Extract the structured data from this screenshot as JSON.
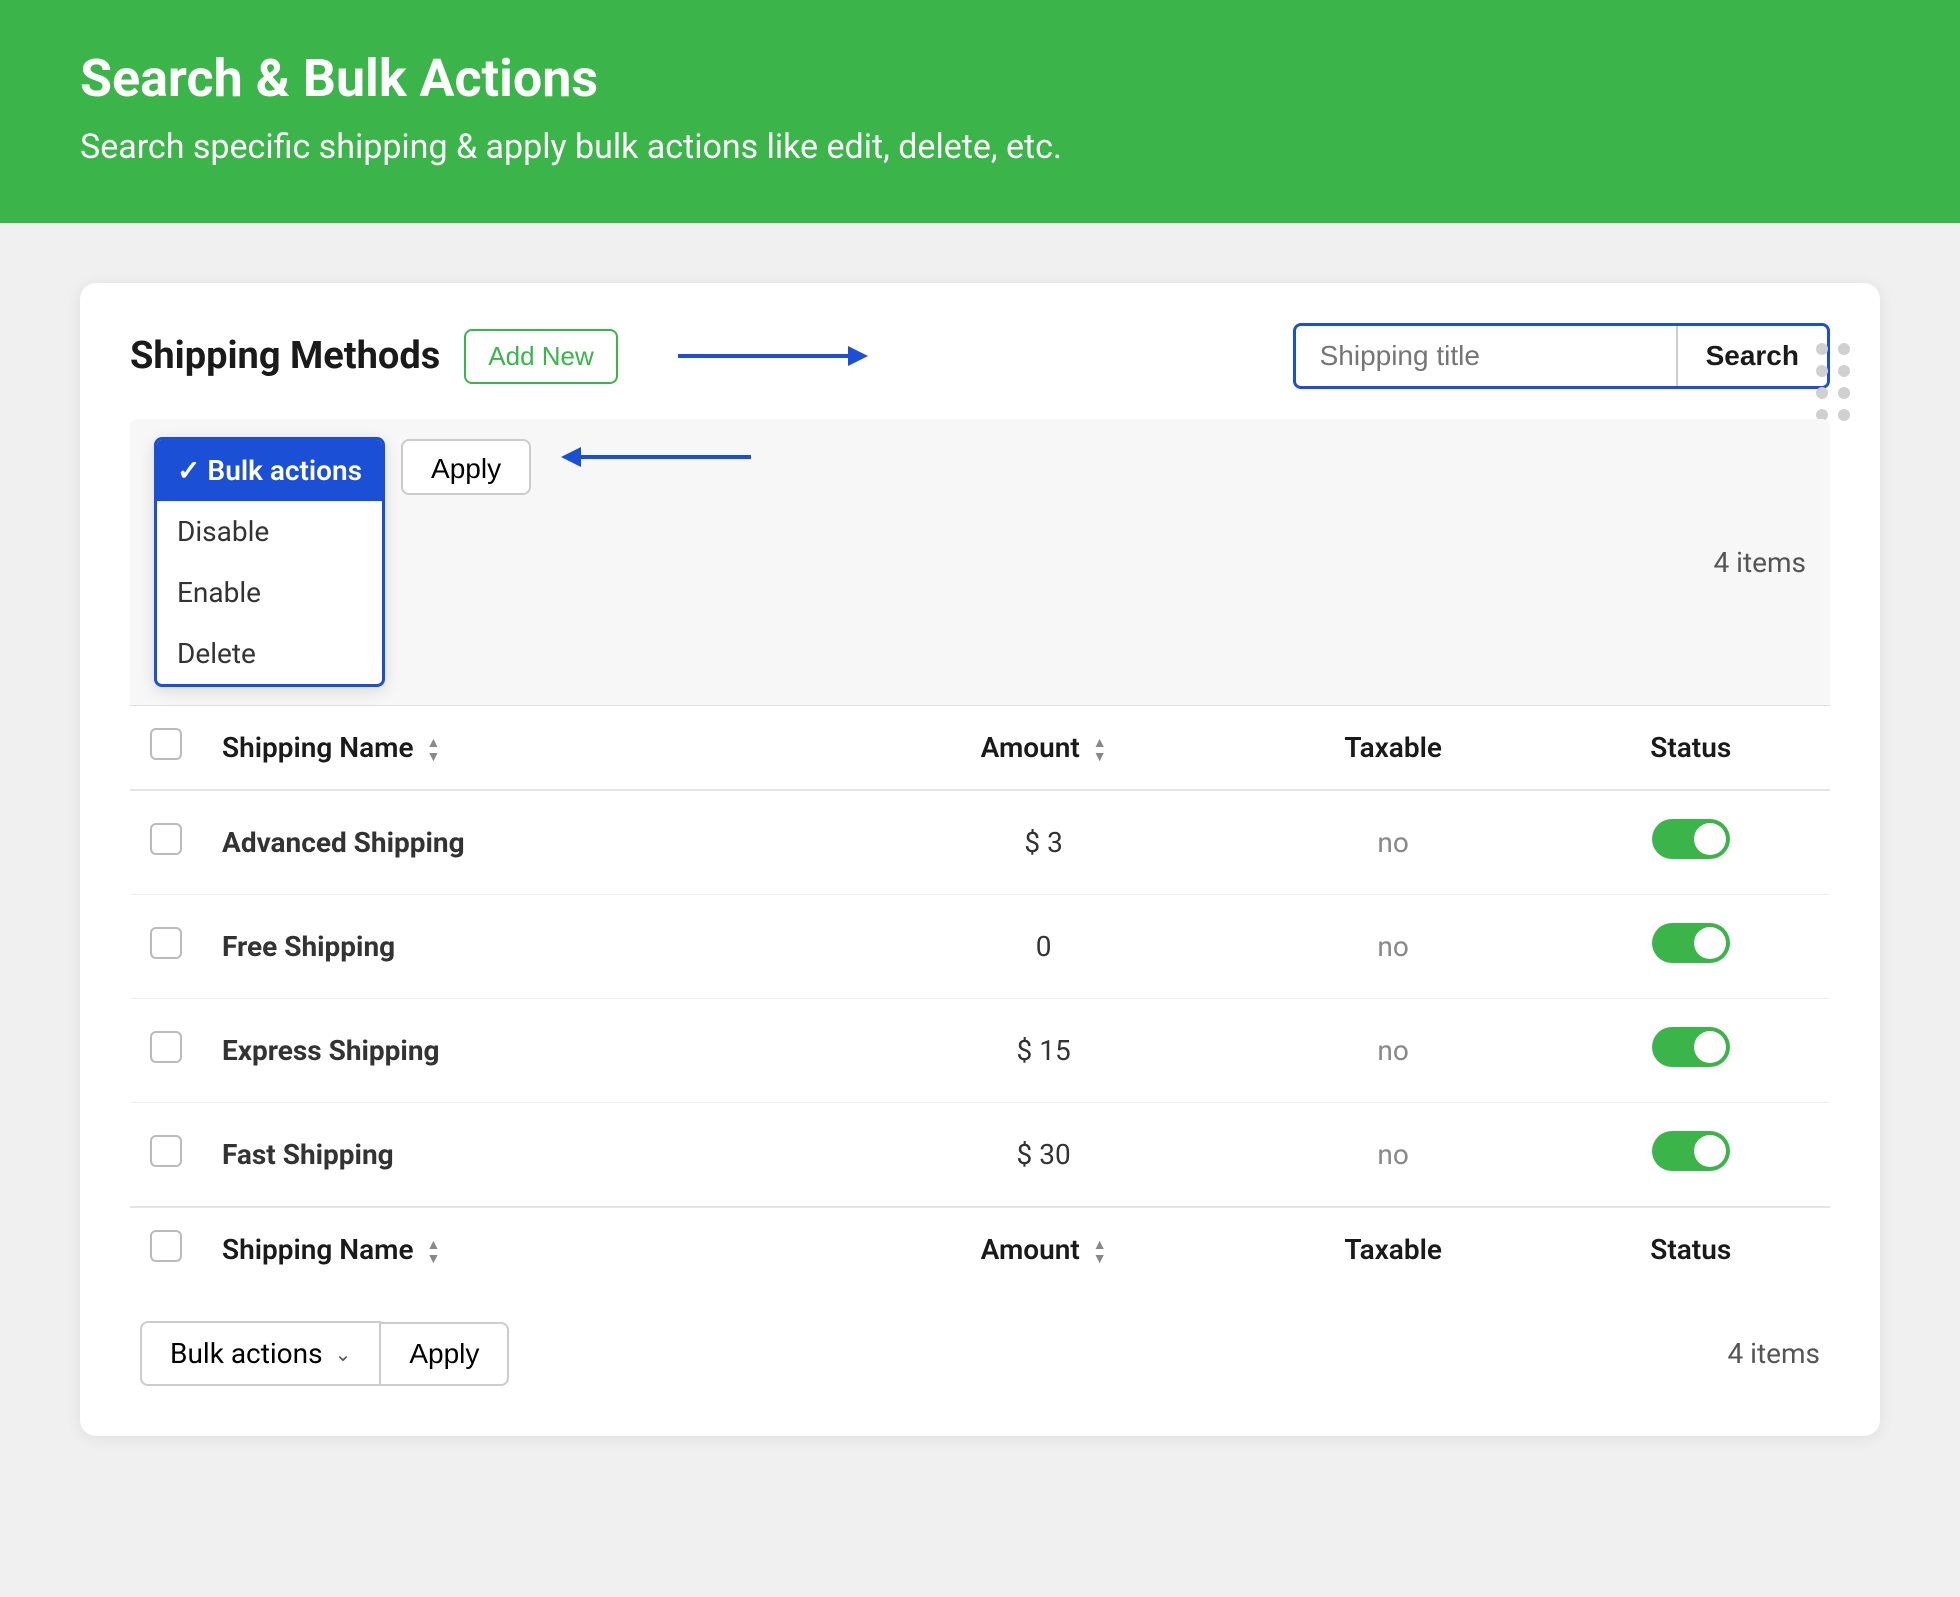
{
  "header": {
    "title": "Search & Bulk Actions",
    "subtitle": "Search specific shipping & apply bulk actions like edit, delete, etc."
  },
  "card": {
    "title": "Shipping Methods",
    "add_new_label": "Add New",
    "search_placeholder": "Shipping title",
    "search_button_label": "Search",
    "items_count": "4 items",
    "items_count_bottom": "4 items"
  },
  "bulk_actions": {
    "selected_label": "✓ Bulk actions",
    "options": [
      "Disable",
      "Enable",
      "Delete"
    ],
    "apply_label": "Apply"
  },
  "bulk_actions_bottom": {
    "label": "Bulk actions",
    "apply_label": "Apply"
  },
  "table": {
    "columns": {
      "name": "Shipping Name",
      "amount": "Amount",
      "taxable": "Taxable",
      "status": "Status"
    },
    "rows": [
      {
        "id": 1,
        "name": "Advanced Shipping",
        "amount": "$ 3",
        "taxable": "no",
        "status": true
      },
      {
        "id": 2,
        "name": "Free Shipping",
        "amount": "0",
        "taxable": "no",
        "status": true
      },
      {
        "id": 3,
        "name": "Express Shipping",
        "amount": "$ 15",
        "taxable": "no",
        "status": true
      },
      {
        "id": 4,
        "name": "Fast Shipping",
        "amount": "$ 30",
        "taxable": "no",
        "status": true
      }
    ]
  },
  "dots": [
    "",
    "",
    "",
    "",
    "",
    "",
    "",
    ""
  ]
}
